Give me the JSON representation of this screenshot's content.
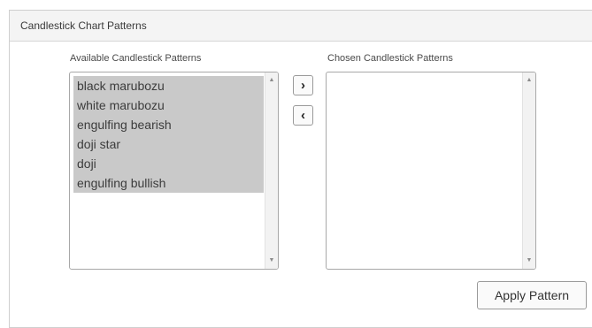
{
  "panel": {
    "title": "Candlestick Chart Patterns"
  },
  "available": {
    "label": "Available Candlestick Patterns",
    "items": [
      "black marubozu",
      "white marubozu",
      "engulfing bearish",
      "doji star",
      "doji",
      "engulfing bullish"
    ]
  },
  "chosen": {
    "label": "Chosen Candlestick Patterns",
    "items": []
  },
  "transfer": {
    "add_label": "›",
    "remove_label": "‹"
  },
  "actions": {
    "apply_label": "Apply Pattern"
  },
  "icons": {
    "scroll_up": "scroll-up-icon",
    "scroll_down": "scroll-down-icon"
  }
}
